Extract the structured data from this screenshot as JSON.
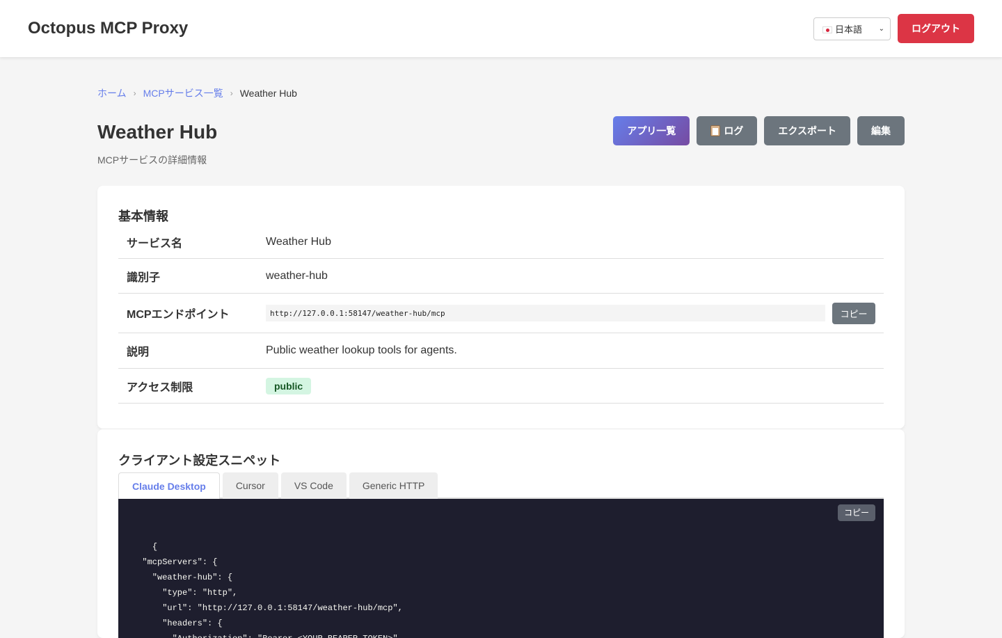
{
  "app": {
    "title": "Octopus MCP Proxy"
  },
  "header": {
    "language": "日本語",
    "logout_label": "ログアウト"
  },
  "breadcrumb": {
    "home": "ホーム",
    "services": "MCPサービス一覧",
    "current": "Weather Hub",
    "separator": "›"
  },
  "page": {
    "title": "Weather Hub",
    "subtitle": "MCPサービスの詳細情報"
  },
  "actions": {
    "apps": "アプリ一覧",
    "logs": "ログ",
    "export": "エクスポート",
    "edit": "編集"
  },
  "basic_info": {
    "title": "基本情報",
    "service_name_label": "サービス名",
    "service_name": "Weather Hub",
    "identifier_label": "識別子",
    "identifier": "weather-hub",
    "endpoint_label": "MCPエンドポイント",
    "endpoint": "http://127.0.0.1:58147/weather-hub/mcp",
    "copy_label": "コピー",
    "description_label": "説明",
    "description": "Public weather lookup tools for agents.",
    "access_label": "アクセス制限",
    "access": "public"
  },
  "snippets": {
    "title": "クライアント設定スニペット",
    "tabs": [
      "Claude Desktop",
      "Cursor",
      "VS Code",
      "Generic HTTP"
    ],
    "active_tab": "Claude Desktop",
    "copy_label": "コピー",
    "code": "{\n  \"mcpServers\": {\n    \"weather-hub\": {\n      \"type\": \"http\",\n      \"url\": \"http://127.0.0.1:58147/weather-hub/mcp\",\n      \"headers\": {\n        \"Authorization\": \"Bearer <YOUR_BEARER_TOKEN>\"\n      }"
  },
  "colors": {
    "accent": "#667eea",
    "danger": "#dc3545",
    "secondary": "#6c757d",
    "code_bg": "#1e1e2e"
  }
}
